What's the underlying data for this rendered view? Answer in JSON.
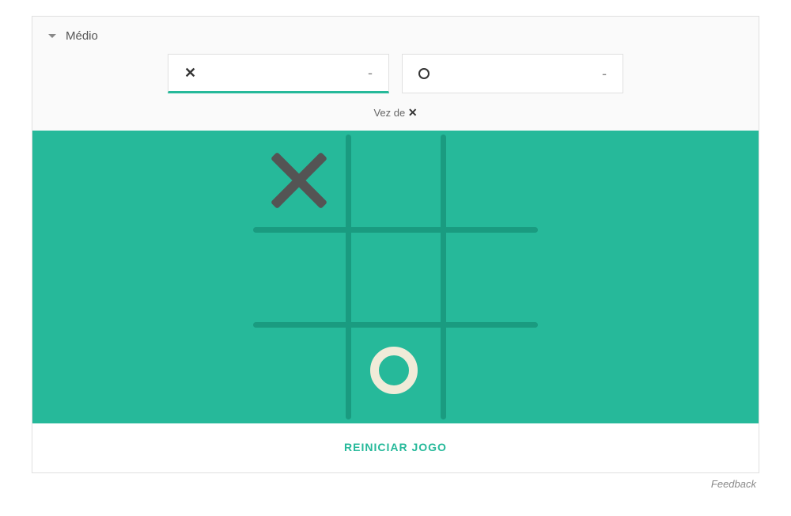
{
  "header": {
    "difficulty": "Médio"
  },
  "scores": {
    "x": {
      "symbol": "✕",
      "value": "-",
      "active": true
    },
    "o": {
      "symbol": "O",
      "value": "-",
      "active": false
    }
  },
  "turn": {
    "prefix": "Vez de ",
    "symbol": "✕"
  },
  "board": {
    "cells": [
      {
        "row": 0,
        "col": 0,
        "mark": "x"
      },
      {
        "row": 0,
        "col": 1,
        "mark": null
      },
      {
        "row": 0,
        "col": 2,
        "mark": null
      },
      {
        "row": 1,
        "col": 0,
        "mark": null
      },
      {
        "row": 1,
        "col": 1,
        "mark": null
      },
      {
        "row": 1,
        "col": 2,
        "mark": null
      },
      {
        "row": 2,
        "col": 0,
        "mark": null
      },
      {
        "row": 2,
        "col": 1,
        "mark": "o"
      },
      {
        "row": 2,
        "col": 2,
        "mark": null
      }
    ]
  },
  "restart": {
    "label": "REINICIAR JOGO"
  },
  "feedback": {
    "label": "Feedback"
  }
}
